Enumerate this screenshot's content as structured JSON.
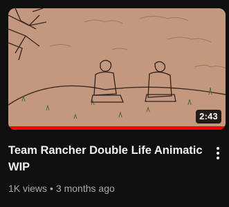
{
  "video": {
    "title": "Team Rancher Double Life Animatic WIP",
    "duration": "2:43",
    "views": "1K views",
    "separator": "•",
    "age": "3 months ago",
    "watch_progress": 1.0
  },
  "icons": {
    "more": "more-vert-icon"
  },
  "colors": {
    "background": "#0f0f0f",
    "title": "#f1f1f1",
    "meta": "#aaaaaa",
    "progress": "#ff0000",
    "thumbnail_bg": "#c4977f"
  }
}
